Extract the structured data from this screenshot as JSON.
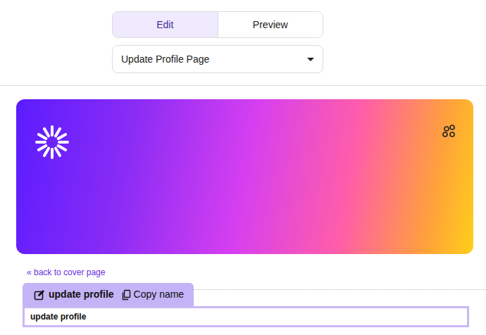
{
  "mode_tabs": [
    {
      "label": "Edit",
      "selected": true
    },
    {
      "label": "Preview",
      "selected": false
    }
  ],
  "page_select": {
    "value": "Update Profile Page"
  },
  "back_link": "« back to cover page",
  "block": {
    "name": "update profile",
    "copy_label": "Copy name",
    "content": "update profile"
  }
}
